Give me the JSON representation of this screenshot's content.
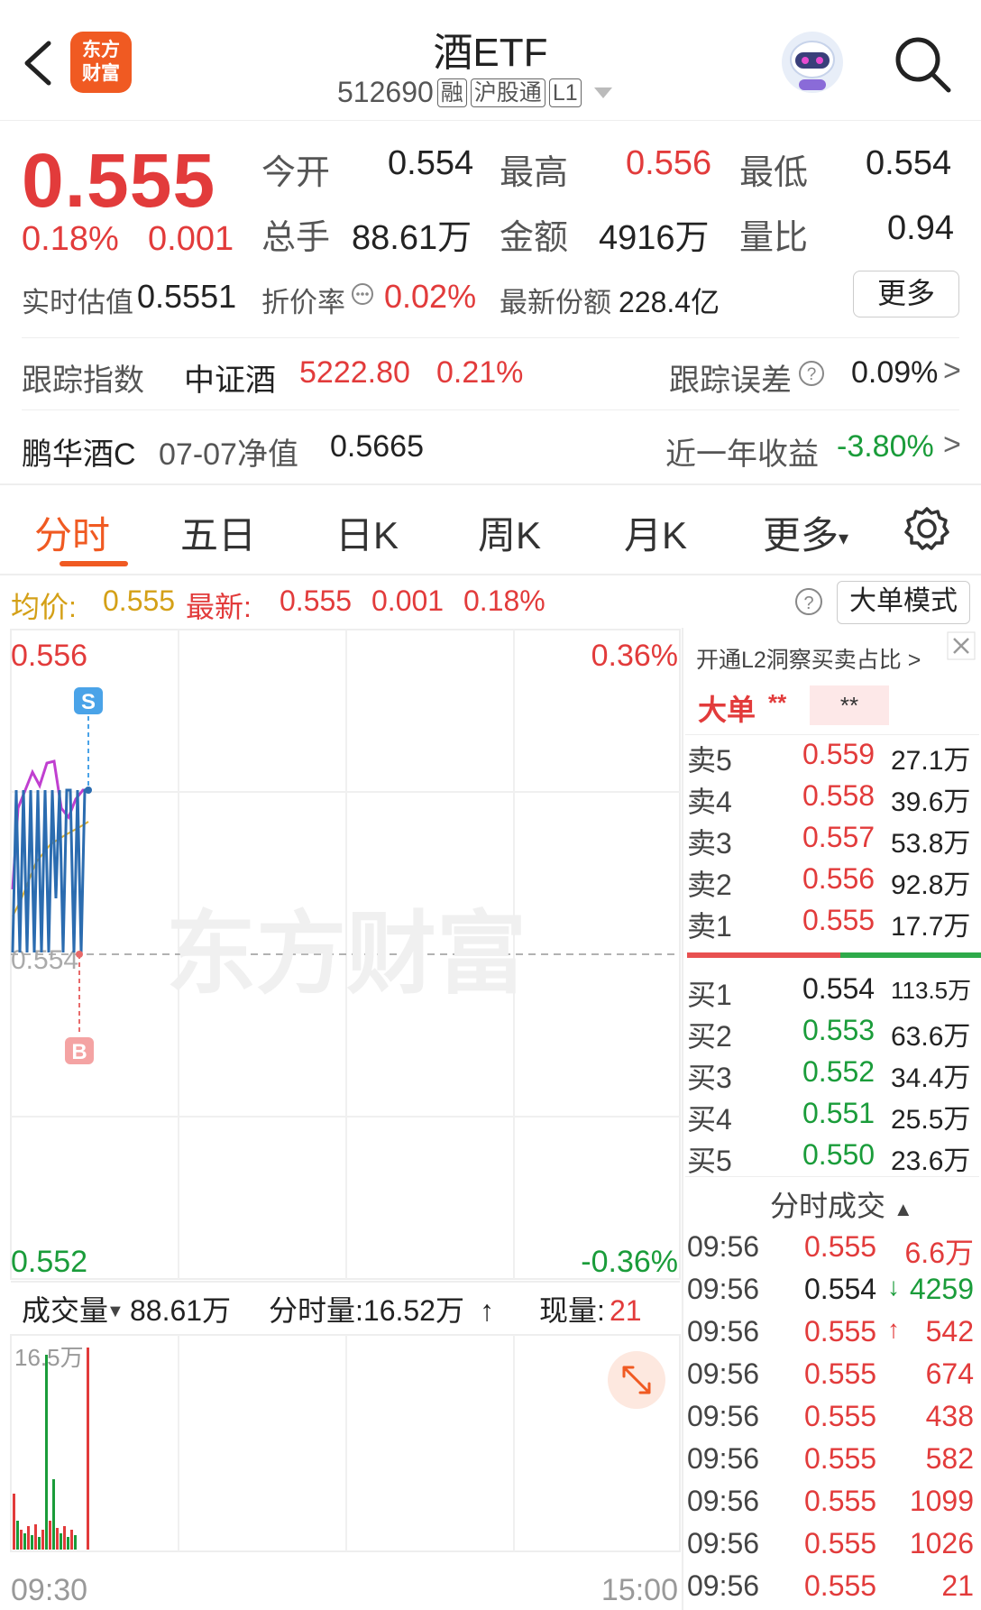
{
  "header": {
    "title": "酒ETF",
    "code": "512690",
    "tags": [
      "融",
      "沪股通",
      "L1"
    ],
    "logo_line1": "东方",
    "logo_line2": "财富"
  },
  "quote": {
    "price": "0.555",
    "change_pct": "0.18%",
    "change": "0.001",
    "open_label": "今开",
    "open": "0.554",
    "high_label": "最高",
    "high": "0.556",
    "low_label": "最低",
    "low": "0.554",
    "volume_label": "总手",
    "volume": "88.61万",
    "amount_label": "金额",
    "amount": "4916万",
    "ratio_label": "量比",
    "ratio": "0.94",
    "iopv_label": "实时估值",
    "iopv": "0.5551",
    "discount_label": "折价率",
    "discount": "0.02%",
    "shares_label": "最新份额",
    "shares": "228.4亿",
    "more_label": "更多"
  },
  "tracking": {
    "index_label": "跟踪指数",
    "index_name": "中证酒",
    "index_value": "5222.80",
    "index_change": "0.21%",
    "error_label": "跟踪误差",
    "error_value": "0.09%",
    "fund_name": "鹏华酒C",
    "nav_label": "07-07净值",
    "nav_value": "0.5665",
    "year_label": "近一年收益",
    "year_value": "-3.80%"
  },
  "tabs": [
    "分时",
    "五日",
    "日K",
    "周K",
    "月K",
    "更多"
  ],
  "chart_info": {
    "avg_label": "均价:",
    "avg_value": "0.555",
    "latest_label": "最新:",
    "latest_value": "0.555",
    "latest_change": "0.001",
    "latest_pct": "0.18%",
    "big_order_btn": "大单模式",
    "y_top": "0.556",
    "y_mid": "0.554",
    "y_bottom": "0.552",
    "pct_top": "0.36%",
    "pct_bottom": "-0.36%",
    "watermark": "东方财富",
    "marker_s": "S",
    "marker_b": "B"
  },
  "volume_bar": {
    "label": "成交量",
    "total": "88.61万",
    "min_label": "分时量:16.52万",
    "now_label": "现量:",
    "now_value": "21",
    "y_max": "16.5万",
    "x_start": "09:30",
    "x_end": "15:00"
  },
  "orderbook": {
    "promo": "开通L2洞察买卖占比",
    "big_label": "大单",
    "masked1": "**",
    "masked2": "**",
    "asks": [
      {
        "label": "卖5",
        "price": "0.559",
        "vol": "27.1万"
      },
      {
        "label": "卖4",
        "price": "0.558",
        "vol": "39.6万"
      },
      {
        "label": "卖3",
        "price": "0.557",
        "vol": "53.8万"
      },
      {
        "label": "卖2",
        "price": "0.556",
        "vol": "92.8万"
      },
      {
        "label": "卖1",
        "price": "0.555",
        "vol": "17.7万"
      }
    ],
    "bids": [
      {
        "label": "买1",
        "price": "0.554",
        "vol": "113.5万"
      },
      {
        "label": "买2",
        "price": "0.553",
        "vol": "63.6万"
      },
      {
        "label": "买3",
        "price": "0.552",
        "vol": "34.4万"
      },
      {
        "label": "买4",
        "price": "0.551",
        "vol": "25.5万"
      },
      {
        "label": "买5",
        "price": "0.550",
        "vol": "23.6万"
      }
    ],
    "trades_title": "分时成交",
    "trades": [
      {
        "time": "09:56",
        "price": "0.555",
        "arrow": "",
        "vol": "6.6万",
        "color": "red"
      },
      {
        "time": "09:56",
        "price": "0.554",
        "arrow": "↓",
        "vol": "4259",
        "color": "green"
      },
      {
        "time": "09:56",
        "price": "0.555",
        "arrow": "↑",
        "vol": "542",
        "color": "red"
      },
      {
        "time": "09:56",
        "price": "0.555",
        "arrow": "",
        "vol": "674",
        "color": "red"
      },
      {
        "time": "09:56",
        "price": "0.555",
        "arrow": "",
        "vol": "438",
        "color": "red"
      },
      {
        "time": "09:56",
        "price": "0.555",
        "arrow": "",
        "vol": "582",
        "color": "red"
      },
      {
        "time": "09:56",
        "price": "0.555",
        "arrow": "",
        "vol": "1099",
        "color": "red"
      },
      {
        "time": "09:56",
        "price": "0.555",
        "arrow": "",
        "vol": "1026",
        "color": "red"
      },
      {
        "time": "09:56",
        "price": "0.555",
        "arrow": "",
        "vol": "21",
        "color": "red"
      }
    ]
  },
  "colors": {
    "red": "#e23b3b",
    "green": "#1a9c3a",
    "orange": "#f05a22",
    "gold": "#d4a017",
    "price_line": "#2b6cb0",
    "avg_line": "#c03fd0"
  }
}
